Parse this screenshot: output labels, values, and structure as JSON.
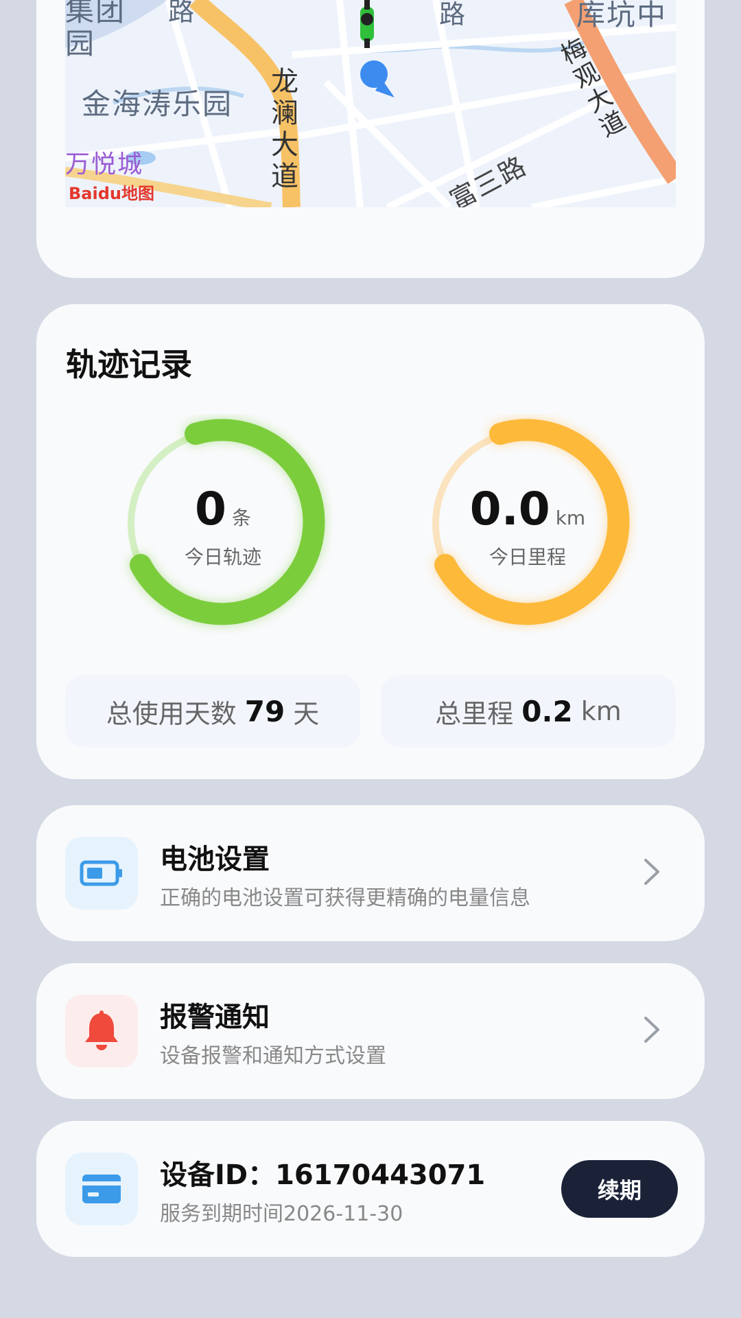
{
  "map": {
    "labels": {
      "jihe_tuan": "集团",
      "jihe_yuan": "园",
      "lu_left": "路",
      "lu_top": "路",
      "kukeng": "库坑中",
      "jinhai": "金海涛乐园",
      "longlan": "龙澜大道",
      "meiguan": "梅观大道",
      "fusan": "富三路",
      "wanyue": "万悦城",
      "baidu_logo": "Baidu地图"
    }
  },
  "track": {
    "title": "轨迹记录",
    "today_tracks": {
      "value": "0",
      "unit": "条",
      "label": "今日轨迹",
      "color": "#7ccd3c"
    },
    "today_mileage": {
      "value": "0.0",
      "unit": "km",
      "label": "今日里程",
      "color": "#fdb93a"
    },
    "total_days": {
      "prefix": "总使用天数",
      "value": "79",
      "unit": "天"
    },
    "total_mileage": {
      "prefix": "总里程",
      "value": "0.2",
      "unit": "km"
    }
  },
  "battery": {
    "title": "电池设置",
    "subtitle": "正确的电池设置可获得更精确的电量信息",
    "icon": "battery-icon",
    "color": "#3c9be8"
  },
  "alarm": {
    "title": "报警通知",
    "subtitle": "设备报警和通知方式设置",
    "icon": "bell-icon",
    "color": "#ef4a3c"
  },
  "device": {
    "title": "设备ID：16170443071",
    "subtitle": "服务到期时间2026-11-30",
    "renew_label": "续期",
    "icon": "card-icon"
  }
}
